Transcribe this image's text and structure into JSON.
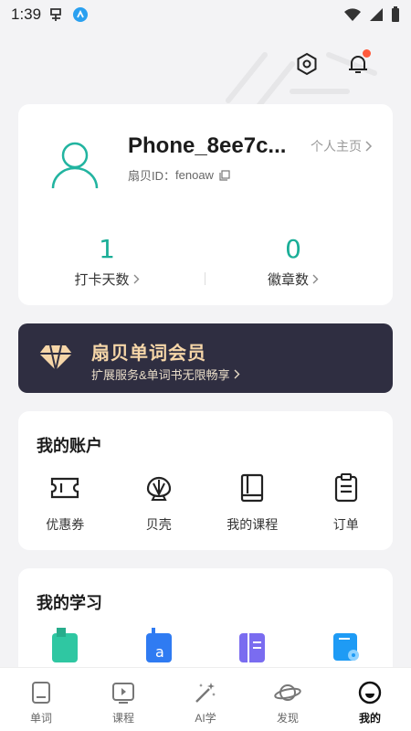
{
  "status_bar": {
    "time": "1:39"
  },
  "profile": {
    "username": "Phone_8ee7c...",
    "homepage_link": "个人主页",
    "shanbay_id_label": "扇贝ID：",
    "shanbay_id": "fenoaw",
    "stats": [
      {
        "value": "1",
        "label": "打卡天数"
      },
      {
        "value": "0",
        "label": "徽章数"
      }
    ]
  },
  "vip": {
    "title": "扇贝单词会员",
    "subtitle": "扩展服务&单词书无限畅享"
  },
  "account": {
    "title": "我的账户",
    "items": [
      {
        "label": "优惠券",
        "icon": "coupon-icon"
      },
      {
        "label": "贝壳",
        "icon": "shell-icon"
      },
      {
        "label": "我的课程",
        "icon": "course-book-icon"
      },
      {
        "label": "订单",
        "icon": "order-clipboard-icon"
      }
    ]
  },
  "study": {
    "title": "我的学习",
    "items": [
      {
        "icon": "green-book-icon",
        "color": "#2fc7a2"
      },
      {
        "icon": "blue-word-book-icon",
        "color": "#2f7bf2"
      },
      {
        "icon": "purple-notebook-icon",
        "color": "#7a6cf0"
      },
      {
        "icon": "blue-settings-book-icon",
        "color": "#1e9bf5"
      }
    ]
  },
  "tabs": [
    {
      "label": "单词",
      "icon": "word-card-icon",
      "active": false
    },
    {
      "label": "课程",
      "icon": "video-play-icon",
      "active": false
    },
    {
      "label": "AI学",
      "icon": "magic-wand-icon",
      "active": false
    },
    {
      "label": "发现",
      "icon": "planet-icon",
      "active": false
    },
    {
      "label": "我的",
      "icon": "smiley-face-icon",
      "active": true
    }
  ],
  "colors": {
    "accent": "#1aae97",
    "vip_bg": "#2f2e41",
    "vip_text": "#f6d6a8",
    "notification_dot": "#ff5a3c"
  }
}
